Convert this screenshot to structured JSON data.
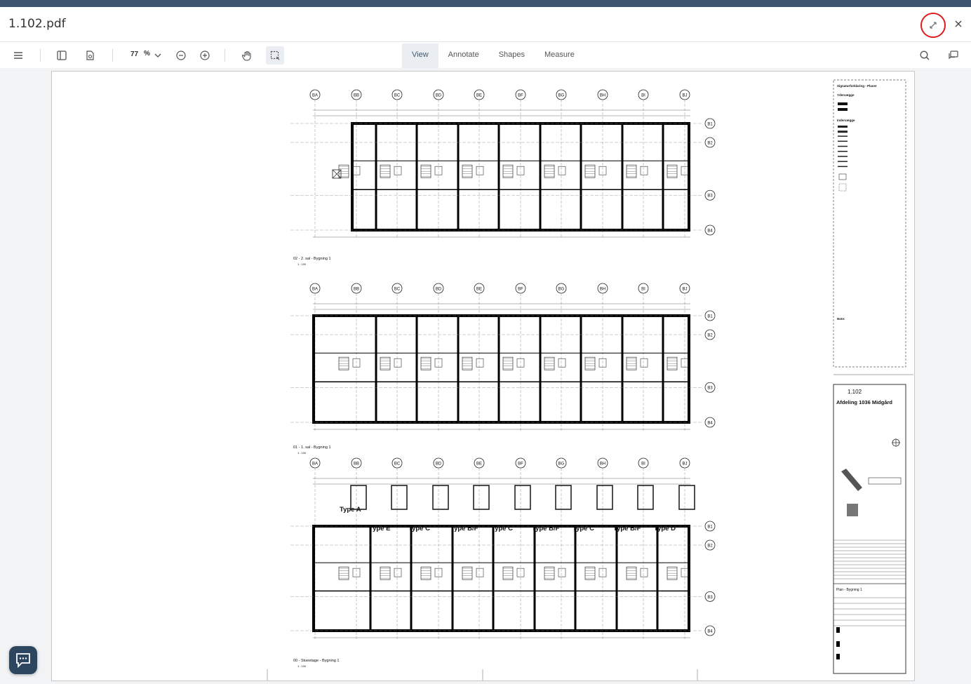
{
  "window": {
    "file_name": "1.102.pdf"
  },
  "toolbar": {
    "zoom_value": "77",
    "zoom_unit": "%",
    "tabs": [
      {
        "label": "View",
        "active": true
      },
      {
        "label": "Annotate",
        "active": false
      },
      {
        "label": "Shapes",
        "active": false
      },
      {
        "label": "Measure",
        "active": false
      }
    ]
  },
  "drawing": {
    "grid_labels": [
      "BA",
      "BB",
      "BC",
      "BD",
      "BE",
      "BF",
      "BG",
      "BH",
      "BI",
      "BJ"
    ],
    "row_labels": [
      "B1",
      "B2",
      "B3",
      "B4"
    ],
    "plans": [
      {
        "caption": "02 - 2. sal - Bygning 1",
        "scale": "1 : 100"
      },
      {
        "caption": "01 - 1. sal - Bygning 1",
        "scale": "1 : 100"
      },
      {
        "caption": "00 - Stueetage - Bygning 1",
        "scale": "1 : 100"
      }
    ],
    "unit_types": [
      "Type A",
      "Type E",
      "Type C",
      "Type B/F",
      "Type C",
      "Type B/F",
      "Type C",
      "Type B/F",
      "Type D"
    ],
    "legend": {
      "title": "Signaturforklaring - Planer",
      "exterior": "Ydervægge",
      "interior": "Indervægge",
      "note": "Note:"
    },
    "titleblock": {
      "sheet_no": "1.102",
      "project": "Afdeling 1036 Midgård",
      "drawing_name": "Plan - Bygning 1"
    }
  },
  "colors": {
    "header": "#3e556f",
    "accent_ring": "#e01c1c",
    "chat": "#2c4660"
  }
}
